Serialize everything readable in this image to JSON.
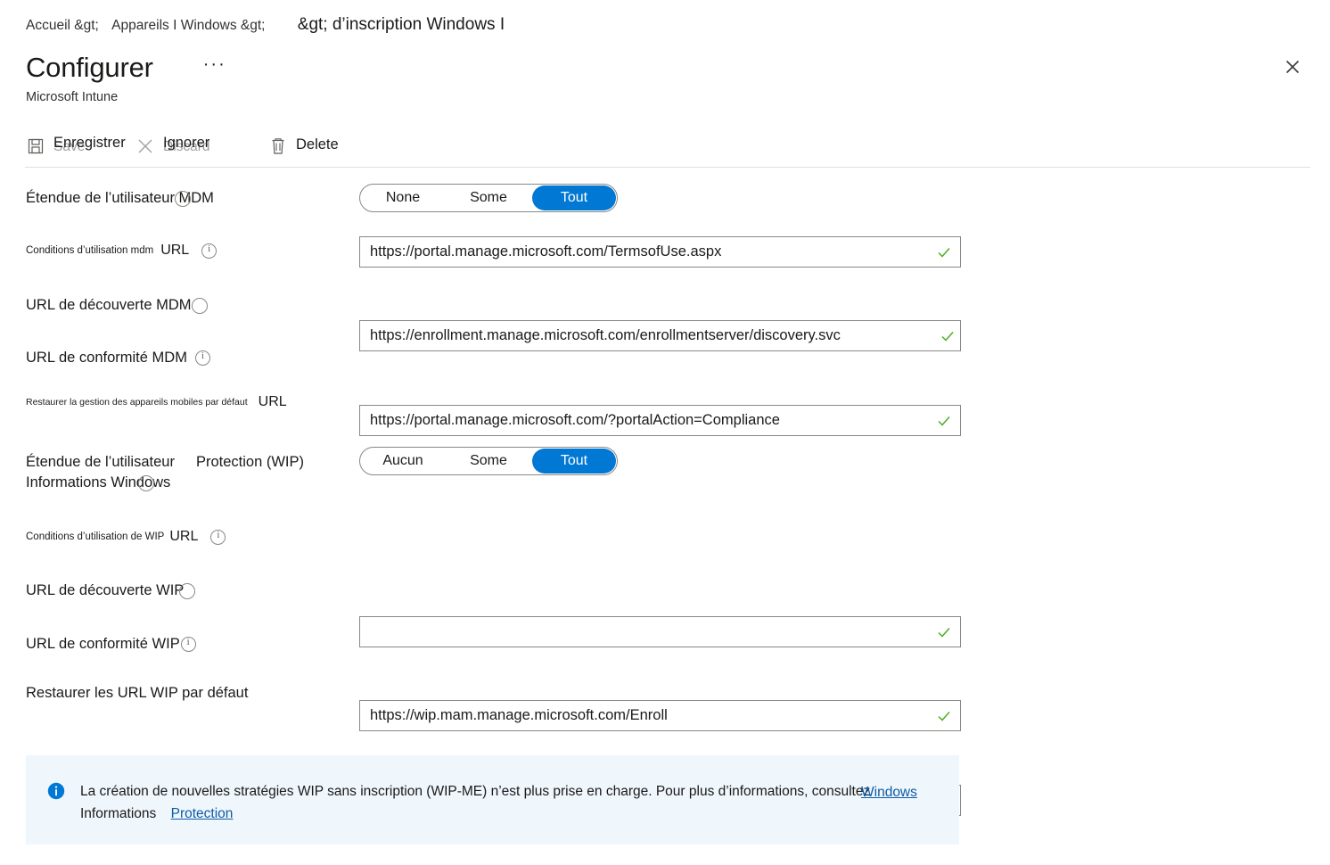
{
  "breadcrumb": {
    "item1": "Accueil &gt;",
    "item2": "Appareils I Windows &gt;",
    "item3": "&gt; d’inscription Windows I"
  },
  "header": {
    "title": "Configurer",
    "ellipsis": "···",
    "subtitle": "Microsoft Intune",
    "close_icon": "close-icon"
  },
  "toolbar": {
    "save_en": "Save",
    "save_fr": "Enregistrer",
    "discard_en": "Discard",
    "discard_fr": "Ignorer",
    "delete": "Delete",
    "save_icon": "floppy-disk-icon",
    "discard_icon": "x-icon",
    "delete_icon": "trash-icon"
  },
  "form": {
    "mdm_scope": {
      "label": "Étendue de l’utilisateur MDM",
      "options": [
        "None",
        "Some",
        "Tout"
      ],
      "selected": "Tout"
    },
    "mdm_terms": {
      "label_small": "Conditions d’utilisation mdm",
      "label_url": "URL",
      "value": "https://portal.manage.microsoft.com/TermsofUse.aspx",
      "valid": true
    },
    "mdm_discovery": {
      "label": "URL de découverte MDM",
      "value": "https://enrollment.manage.microsoft.com/enrollmentserver/discovery.svc",
      "valid": true
    },
    "mdm_compliance": {
      "label": "URL de conformité MDM",
      "value": "https://portal.manage.microsoft.com/?portalAction=Compliance",
      "valid": true
    },
    "mdm_restore": {
      "label_small": "Restaurer la gestion des appareils mobiles par défaut",
      "label_url": "URL"
    },
    "wip_scope": {
      "label_line1": "Étendue de l’utilisateur",
      "label_line1b": "Protection (WIP)",
      "label_line2": "Informations Windows",
      "options": [
        "Aucun",
        "Some",
        "Tout"
      ],
      "selected": "Tout"
    },
    "wip_terms": {
      "label_small": "Conditions d’utilisation de WIP",
      "label_url": "URL",
      "value": "",
      "valid": true
    },
    "wip_discovery": {
      "label": "URL de découverte WIP",
      "value": "https://wip.mam.manage.microsoft.com/Enroll",
      "valid": true
    },
    "wip_compliance": {
      "label": "URL de conformité WIP",
      "value": "",
      "valid": true
    },
    "wip_restore": {
      "label": "Restaurer les URL WIP par défaut"
    }
  },
  "banner": {
    "icon": "info-icon",
    "line1": "La création de nouvelles stratégies WIP sans inscription (WIP-ME) n’est plus prise en charge. Pour plus d’informations, consultez",
    "line1_link": "Windows",
    "line2_text": "Informations",
    "line2_link": "Protection"
  },
  "colors": {
    "accent": "#0078d4",
    "valid_check": "#4caf22",
    "banner_bg": "#eff6fc",
    "link": "#0f5ba7"
  }
}
